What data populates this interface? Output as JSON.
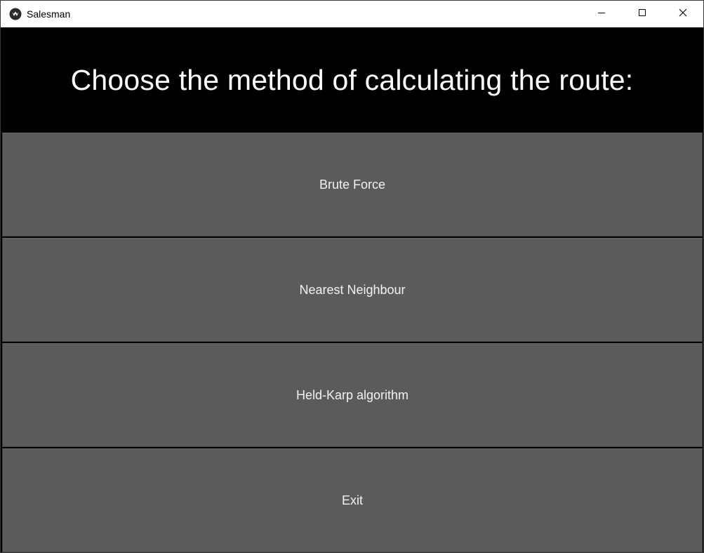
{
  "window": {
    "title": "Salesman",
    "app_icon": "kivy-logo-icon",
    "controls": {
      "minimize": "minimize-icon",
      "maximize": "maximize-icon",
      "close": "close-icon"
    }
  },
  "header": {
    "title": "Choose the method of calculating the route:"
  },
  "buttons": [
    {
      "label": "Brute Force"
    },
    {
      "label": "Nearest Neighbour"
    },
    {
      "label": "Held-Karp algorithm"
    },
    {
      "label": "Exit"
    }
  ],
  "colors": {
    "background": "#000000",
    "button": "#5b5b5b",
    "button_text": "#f2f2f2",
    "title_text": "#ffffff",
    "titlebar": "#ffffff"
  }
}
